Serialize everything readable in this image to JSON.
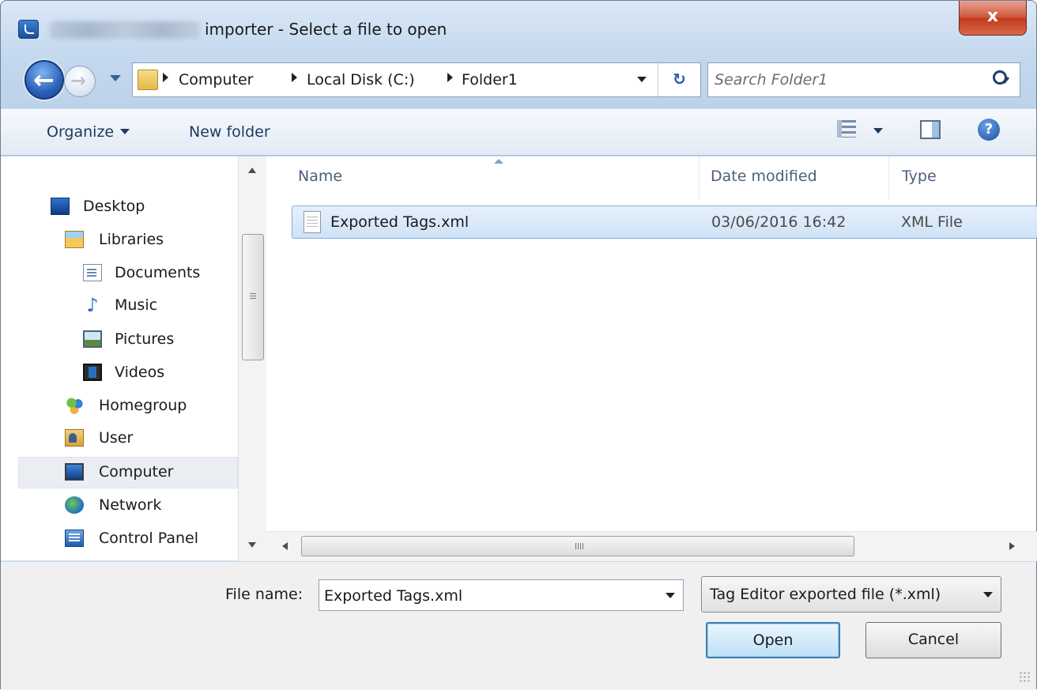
{
  "window": {
    "title": "importer - Select a file to open",
    "close_label": "x"
  },
  "address_bar": {
    "breadcrumbs": [
      "Computer",
      "Local Disk (C:)",
      "Folder1"
    ],
    "refresh_label": "↻"
  },
  "search": {
    "placeholder": "Search Folder1"
  },
  "toolbar": {
    "organize_label": "Organize",
    "new_folder_label": "New folder",
    "help_label": "?"
  },
  "navigation": {
    "items": [
      {
        "label": "Desktop",
        "icon": "desktop-icon"
      },
      {
        "label": "Libraries",
        "icon": "libraries-icon"
      },
      {
        "label": "Documents",
        "icon": "documents-icon"
      },
      {
        "label": "Music",
        "icon": "music-icon"
      },
      {
        "label": "Pictures",
        "icon": "pictures-icon"
      },
      {
        "label": "Videos",
        "icon": "videos-icon"
      },
      {
        "label": "Homegroup",
        "icon": "homegroup-icon"
      },
      {
        "label": "User",
        "icon": "user-icon"
      },
      {
        "label": "Computer",
        "icon": "computer-icon",
        "selected": true
      },
      {
        "label": "Network",
        "icon": "network-icon"
      },
      {
        "label": "Control Panel",
        "icon": "control-panel-icon"
      }
    ]
  },
  "file_list": {
    "columns": [
      "Name",
      "Date modified",
      "Type"
    ],
    "rows": [
      {
        "name": "Exported Tags.xml",
        "date_modified": "03/06/2016 16:42",
        "type": "XML File",
        "selected": true
      }
    ],
    "scroll_grip": "III"
  },
  "footer": {
    "file_name_label": "File name:",
    "file_name_value": "Exported Tags.xml",
    "file_type": "Tag Editor exported file (*.xml)",
    "open_label": "Open",
    "cancel_label": "Cancel"
  },
  "colors": {
    "selection": "#cfe2f7",
    "selection_border": "#84acdd",
    "close_button": "#c23a1c",
    "default_button_border": "#3c7fb1"
  }
}
